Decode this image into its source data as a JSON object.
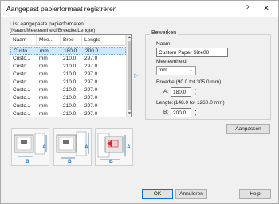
{
  "window": {
    "title": "Aangepast papierformaat registreren",
    "help": "?",
    "close": "✕"
  },
  "list": {
    "caption_line1": "Lijst aangepaste papierformaten:",
    "caption_line2": "(Naam/Meeteenheid/Breedte/Lengte)",
    "headers": [
      "Naam",
      "Mee...",
      "Bree",
      "Lengte"
    ],
    "rows": [
      [
        "Custo...",
        "mm",
        "180.0",
        "200.0"
      ],
      [
        "Custo...",
        "mm",
        "210.0",
        "297.0"
      ],
      [
        "Custo...",
        "mm",
        "210.0",
        "297.0"
      ],
      [
        "Custo...",
        "mm",
        "210.0",
        "297.0"
      ],
      [
        "Custo...",
        "mm",
        "210.0",
        "297.0"
      ],
      [
        "Custo...",
        "mm",
        "210.0",
        "297.0"
      ],
      [
        "Custo...",
        "mm",
        "210.0",
        "297.0"
      ],
      [
        "Custo...",
        "mm",
        "210.0",
        "297.0"
      ],
      [
        "Custo...",
        "mm",
        "210.0",
        "297.0"
      ]
    ],
    "selected_index": 0
  },
  "edit": {
    "group_title": "Bewerken",
    "name_label": "Naam:",
    "name_value": "Custom Paper Size00",
    "unit_label": "Meeteenheid:",
    "unit_value": "mm",
    "width_label": "Breedte:(90.0 tot 305.0 mm)",
    "width_prefix": "A:",
    "width_value": "180.0",
    "length_label": "Lengte:(148.0 tot 1260.0 mm)",
    "length_prefix": "B:",
    "length_value": "200.0"
  },
  "buttons": {
    "apply": "Aanpassen",
    "ok": "OK",
    "cancel": "Annuleren",
    "help": "Help"
  },
  "illustrations": {
    "label_a": "A",
    "label_b": "B"
  },
  "colors": {
    "selection": "#cce8ff",
    "accent": "#0078d7",
    "dimension_arrow": "#2e75b6",
    "feed_arrow": "#d9262c"
  }
}
